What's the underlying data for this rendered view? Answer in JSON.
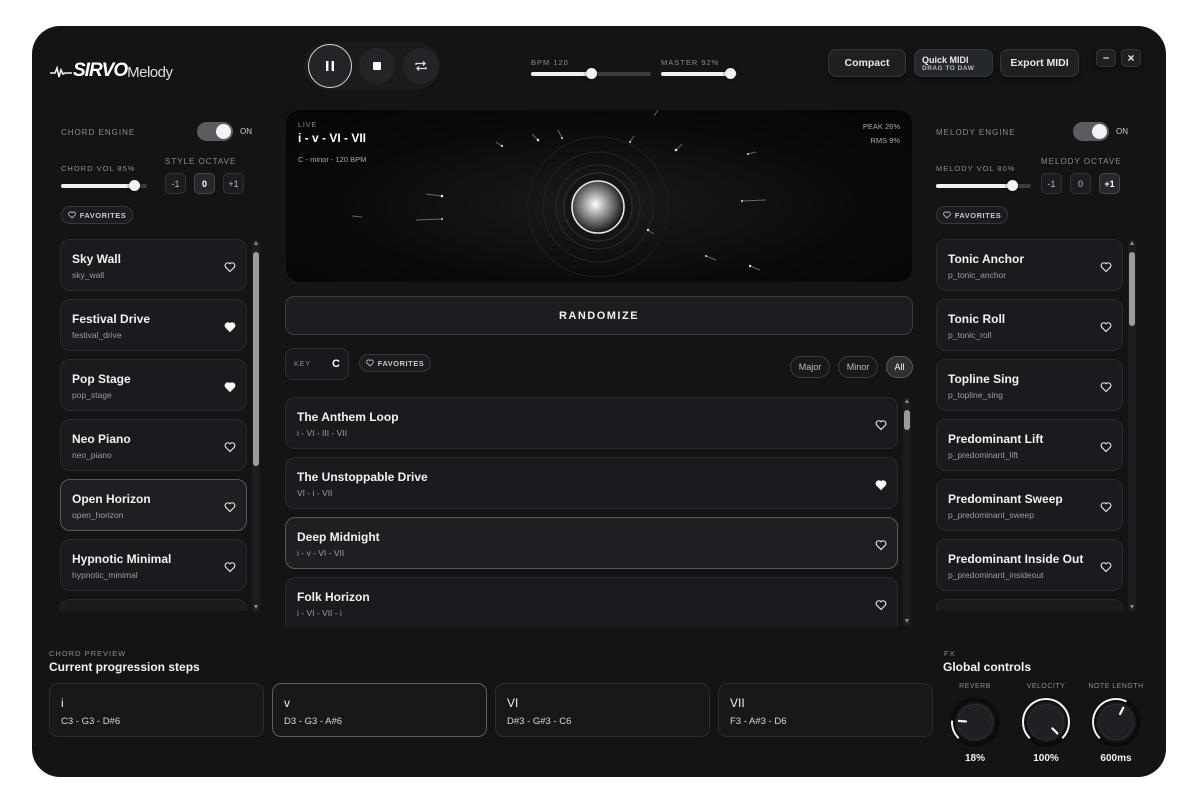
{
  "brand": {
    "logo_bold": "SIRVO",
    "logo_light": "Melody"
  },
  "transport": {
    "pause": "pause",
    "stop": "stop",
    "loop": "loop"
  },
  "header": {
    "bpm_label": "BPM 120",
    "bpm_fraction": 0.5,
    "master_label": "MASTER 92%",
    "master_fraction": 0.92,
    "compact": "Compact",
    "quick_midi": "Quick MIDI",
    "quick_midi_sub": "DRAG TO DAW",
    "export_midi": "Export MIDI",
    "minimize": "–",
    "close": "×"
  },
  "chord_engine": {
    "title": "CHORD ENGINE",
    "toggle_state": "ON",
    "vol_label": "CHORD VOL 85%",
    "vol_fraction": 0.85,
    "octave_label": "STYLE OCTAVE",
    "octave_options": [
      "-1",
      "0",
      "+1"
    ],
    "octave_selected": "0",
    "favorites": "FAVORITES",
    "presets": [
      {
        "name": "Sky Wall",
        "id": "sky_wall",
        "fav": false
      },
      {
        "name": "Festival Drive",
        "id": "festival_drive",
        "fav": true
      },
      {
        "name": "Pop Stage",
        "id": "pop_stage",
        "fav": true
      },
      {
        "name": "Neo Piano",
        "id": "neo_piano",
        "fav": false
      },
      {
        "name": "Open Horizon",
        "id": "open_horizon",
        "fav": false,
        "selected": true
      },
      {
        "name": "Hypnotic Minimal",
        "id": "hypnotic_minimal",
        "fav": false
      }
    ]
  },
  "melody_engine": {
    "title": "MELODY ENGINE",
    "toggle_state": "ON",
    "vol_label": "MELODY VOL 80%",
    "vol_fraction": 0.8,
    "octave_label": "MELODY OCTAVE",
    "octave_options": [
      "-1",
      "0",
      "+1"
    ],
    "octave_selected": "+1",
    "favorites": "FAVORITES",
    "presets": [
      {
        "name": "Tonic Anchor",
        "id": "p_tonic_anchor",
        "fav": false
      },
      {
        "name": "Tonic Roll",
        "id": "p_tonic_roll",
        "fav": false
      },
      {
        "name": "Topline Sing",
        "id": "p_topline_sing",
        "fav": false
      },
      {
        "name": "Predominant Lift",
        "id": "p_predominant_lift",
        "fav": false
      },
      {
        "name": "Predominant Sweep",
        "id": "p_predominant_sweep",
        "fav": false
      },
      {
        "name": "Predominant Inside Out",
        "id": "p_predominant_insideout",
        "fav": false
      }
    ]
  },
  "visualizer": {
    "live": "LIVE",
    "progression": "i - v - VI - VII",
    "info": "C - minor - 120 BPM",
    "peak": "PEAK 26%",
    "rms": "RMS 9%"
  },
  "randomize": "RANDOMIZE",
  "key": {
    "label": "KEY",
    "value": "C",
    "favorites": "FAVORITES",
    "filters": [
      "Major",
      "Minor",
      "All"
    ],
    "filter_selected": "All"
  },
  "progressions": [
    {
      "name": "The Anthem Loop",
      "chords": "i - VI - III - VII",
      "fav": false
    },
    {
      "name": "The Unstoppable Drive",
      "chords": "VI - i - VII",
      "fav": true
    },
    {
      "name": "Deep Midnight",
      "chords": "i - v - VI - VII",
      "fav": false,
      "selected": true
    },
    {
      "name": "Folk Horizon",
      "chords": "i - VI - VII - i",
      "fav": false
    }
  ],
  "preview": {
    "label": "CHORD PREVIEW",
    "title": "Current progression steps",
    "steps": [
      {
        "numeral": "i",
        "notes": "C3 - G3 - D#6"
      },
      {
        "numeral": "v",
        "notes": "D3 - G3 - A#6",
        "selected": true
      },
      {
        "numeral": "VI",
        "notes": "D#3 - G#3 - C6"
      },
      {
        "numeral": "VII",
        "notes": "F3 - A#3 - D6"
      }
    ]
  },
  "fx": {
    "label": "FX",
    "title": "Global controls",
    "knobs": [
      {
        "name": "REVERB",
        "value": "18%",
        "fraction": 0.18
      },
      {
        "name": "VELOCITY",
        "value": "100%",
        "fraction": 1.0
      },
      {
        "name": "NOTE LENGTH",
        "value": "600ms",
        "fraction": 0.6
      }
    ]
  },
  "colors": {
    "bg": "#131416",
    "panel": "#1a1b1e",
    "accent": "#f2f2f2"
  }
}
